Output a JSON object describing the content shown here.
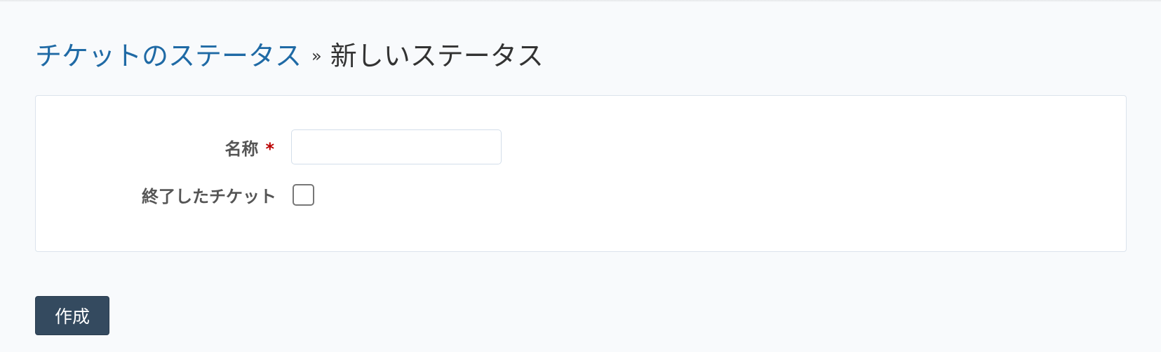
{
  "breadcrumb": {
    "parent_label": "チケットのステータス",
    "separator": "»",
    "current_label": "新しいステータス"
  },
  "form": {
    "name_label": "名称",
    "required_marker": "*",
    "name_value": "",
    "closed_label": "終了したチケット",
    "closed_checked": false,
    "submit_label": "作成"
  },
  "colors": {
    "link": "#1f6aa5",
    "required": "#bb0000",
    "button_bg": "#344a5f",
    "page_bg": "#f8fafc"
  }
}
